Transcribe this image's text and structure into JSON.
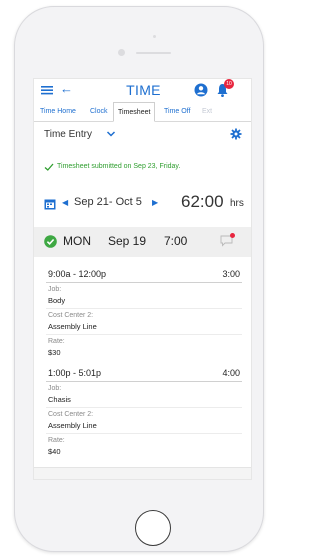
{
  "app": {
    "title": "TIME",
    "notification_count": "10"
  },
  "tabs": [
    {
      "label": "Time Home"
    },
    {
      "label": "Clock"
    },
    {
      "label": "Timesheet"
    },
    {
      "label": "Time Off"
    },
    {
      "label": "Ext"
    }
  ],
  "entry": {
    "label": "Time Entry"
  },
  "notice": {
    "text": "Timesheet submitted on Sep 23, Friday."
  },
  "period": {
    "range": "Sep 21- Oct 5",
    "hours": "62:00",
    "unit": "hrs"
  },
  "day": {
    "name": "MON",
    "date": "Sep 19",
    "total": "7:00"
  },
  "entries": [
    {
      "times": "9:00a - 12:00p",
      "duration": "3:00",
      "job_label": "Job:",
      "job": "Body",
      "cc_label": "Cost Center 2:",
      "cc": "Assembly Line",
      "rate_label": "Rate:",
      "rate": "$30"
    },
    {
      "times": "1:00p - 5:01p",
      "duration": "4:00",
      "job_label": "Job:",
      "job": "Chasis",
      "cc_label": "Cost Center 2:",
      "cc": "Assembly Line",
      "rate_label": "Rate:",
      "rate": "$40"
    }
  ],
  "colors": {
    "accent": "#1e6fd0",
    "success": "#2f9e2f",
    "alert": "#e8263f"
  },
  "icons": [
    "menu-icon",
    "back-arrow-icon",
    "user-icon",
    "bell-icon",
    "chevron-down-icon",
    "gear-icon",
    "check-icon",
    "calendar-icon",
    "prev-arrow-icon",
    "next-arrow-icon",
    "check-circle-icon",
    "comment-icon"
  ]
}
